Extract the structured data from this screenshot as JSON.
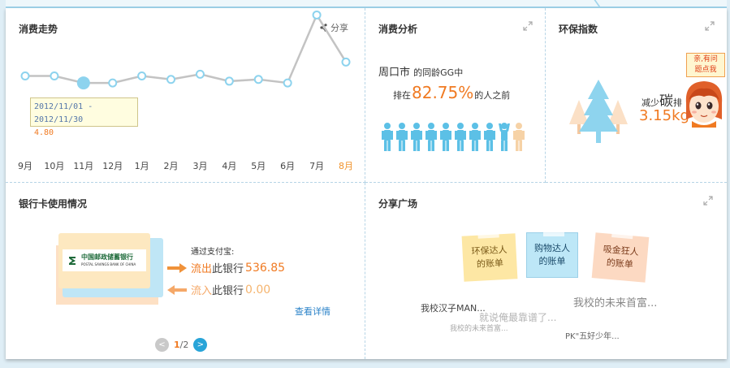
{
  "colors": {
    "accent_orange": "#f07a22",
    "line_gray": "#c3c3c3",
    "point_blue": "#8dd3ee",
    "link_blue": "#2a82c8",
    "divider": "#b6d4e6"
  },
  "trend": {
    "title": "消费走势",
    "share_label": "分享",
    "share_icon": "share-icon",
    "tooltip": {
      "range": "2012/11/01 - 2012/11/30",
      "value": "4.80"
    }
  },
  "chart_data": {
    "type": "line",
    "categories": [
      "9月",
      "10月",
      "11月",
      "12月",
      "1月",
      "2月",
      "3月",
      "4月",
      "5月",
      "6月",
      "7月",
      "8月"
    ],
    "values": [
      4.5,
      4.5,
      4.1,
      4.1,
      4.5,
      4.3,
      4.6,
      4.2,
      4.3,
      4.1,
      8.0,
      5.3
    ],
    "highlight_index": 2,
    "current_index": 11,
    "grid": false,
    "ylim": [
      0,
      9
    ]
  },
  "analysis": {
    "title": "消费分析",
    "city": "周口市",
    "age_text": "的同龄GG中",
    "rank_prefix": "排在",
    "rank_value": "82.75%",
    "rank_suffix": "的人之前",
    "people_total": 10,
    "people_highlight_index": 8,
    "people_raised_index": 8
  },
  "eco": {
    "title": "环保指数",
    "reduce_text": "减少",
    "carbon_text": "碳",
    "emission_text": "排",
    "value": "3.15kg",
    "bubble_line1": "亲,有问",
    "bubble_line2": "题点我"
  },
  "bank": {
    "title": "银行卡使用情况",
    "card_name_cn": "中国邮政储蓄银行",
    "card_name_en": "POSTAL SAVINGS BANK OF CHINA",
    "via_label": "通过支付宝:",
    "out_label": "流出",
    "out_text": "此银行",
    "out_value": "536.85",
    "in_label": "流入",
    "in_text": "此银行",
    "in_value": "0.00",
    "detail_link": "查看详情",
    "page_current": "1",
    "page_total": "/2"
  },
  "share": {
    "title": "分享广场",
    "notes": [
      {
        "line1": "环保达人",
        "line2": "的账单"
      },
      {
        "line1": "购物达人",
        "line2": "的账单"
      },
      {
        "line1": "吸金狂人",
        "line2": "的账单"
      }
    ],
    "items": [
      "我校汉子MAN...",
      "就说俺最靠谱了...",
      "我校的未来首富...",
      "我校的未来首富...",
      "PK\"五好少年..."
    ]
  }
}
